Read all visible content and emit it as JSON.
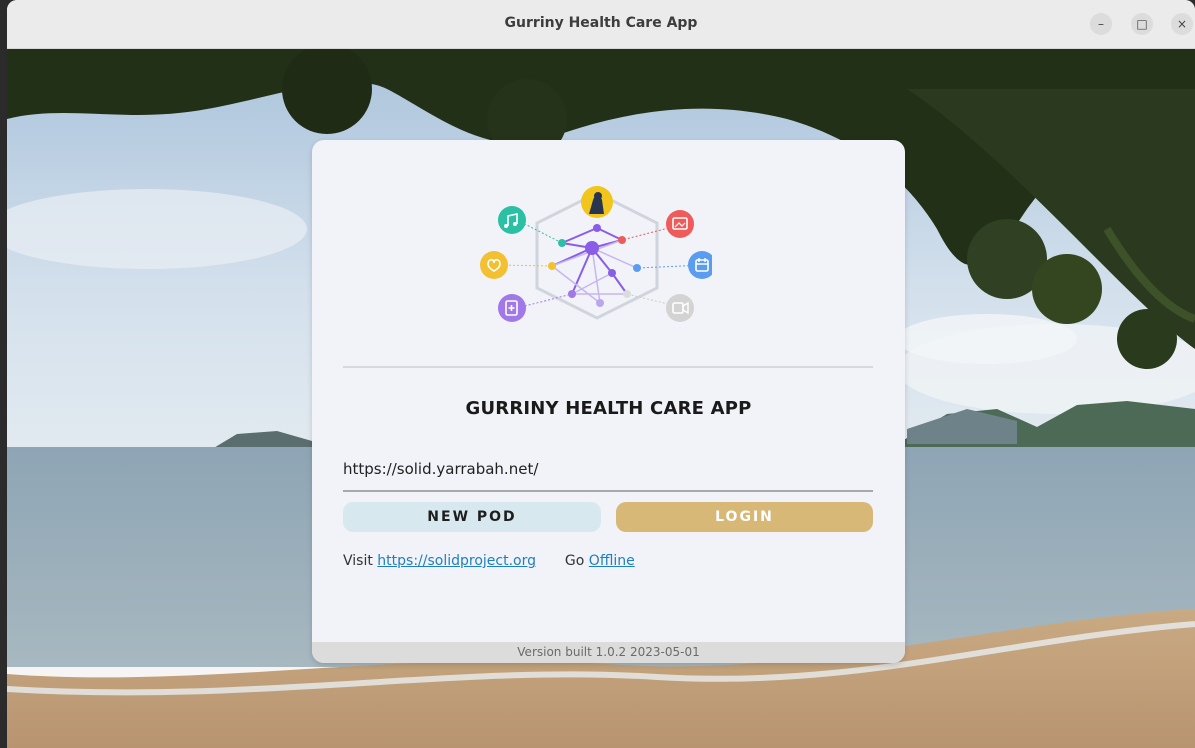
{
  "window": {
    "title": "Gurriny Health Care App",
    "controls": {
      "minimize": "–",
      "maximize": "□",
      "close": "×"
    }
  },
  "background": {
    "description_icon": "beach-landscape",
    "colors": {
      "sky": "#c9d9e8",
      "sea": "#8aa3b3",
      "sand": "#c8a47b",
      "foliage": "#1f2a14"
    }
  },
  "card": {
    "logo_icon": "network-hexagon-logo",
    "app_title": "GURRINY HEALTH CARE APP",
    "pod_url": "https://solid.yarrabah.net/",
    "new_pod_label": "NEW POD",
    "login_label": "LOGIN",
    "visit_text": "Visit",
    "visit_link": "https://solidproject.org",
    "go_text": "Go",
    "offline_link": "Offline",
    "version": "Version built 1.0.2 2023-05-01"
  },
  "colors": {
    "card_bg": "#f1f3f8",
    "new_pod_bg": "#d7e8ef",
    "login_bg": "#d8b876",
    "link": "#1f7fc2"
  }
}
